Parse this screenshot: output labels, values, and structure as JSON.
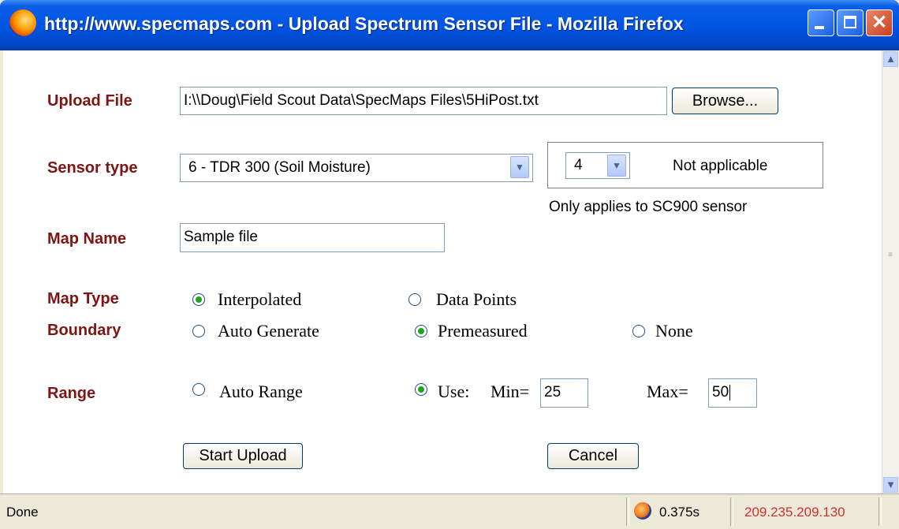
{
  "window": {
    "title": "http://www.specmaps.com - Upload Spectrum Sensor File - Mozilla Firefox",
    "min_glyph": "▁",
    "max_glyph": "▢",
    "close_glyph": "✕"
  },
  "form": {
    "upload_file": {
      "label": "Upload File",
      "value": "I:\\\\Doug\\Field Scout Data\\SpecMaps Files\\5HiPost.txt",
      "browse_label": "Browse..."
    },
    "sensor_type": {
      "label": "Sensor type",
      "selected": "6 - TDR 300 (Soil Moisture)"
    },
    "sc900": {
      "selected": "4",
      "status": "Not applicable",
      "note": "Only applies to SC900 sensor"
    },
    "map_name": {
      "label": "Map Name",
      "value": "Sample file"
    },
    "map_type": {
      "label": "Map Type",
      "options": [
        "Interpolated",
        "Data Points"
      ],
      "selected": "Interpolated"
    },
    "boundary": {
      "label": "Boundary",
      "options": [
        "Auto Generate",
        "Premeasured",
        "None"
      ],
      "selected": "Premeasured"
    },
    "range": {
      "label": "Range",
      "auto_label": "Auto Range",
      "use_label": "Use:",
      "min_label": "Min=",
      "min_value": "25",
      "max_label": "Max=",
      "max_value": "50",
      "selected": "Use"
    },
    "start_upload_label": "Start Upload",
    "cancel_label": "Cancel"
  },
  "statusbar": {
    "status": "Done",
    "time": "0.375s",
    "ip": "209.235.209.130"
  },
  "colors": {
    "label": "#7f1414",
    "title_bar": "#0055e5",
    "radio_dot": "#21a121",
    "ip_text": "#d03030"
  },
  "icons": [
    "firefox-logo-icon",
    "minimize-icon",
    "maximize-icon",
    "close-icon",
    "scroll-up-icon",
    "scroll-down-icon",
    "dropdown-arrow-icon",
    "status-firefox-icon"
  ]
}
